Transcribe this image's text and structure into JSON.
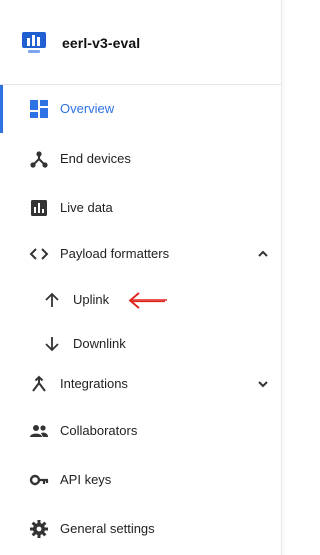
{
  "header": {
    "app_title": "eerl-v3-eval",
    "logo_icon": "monitor-chart-icon"
  },
  "colors": {
    "accent": "#2f72e4",
    "annotation": "#e0201b",
    "icon": "#333333"
  },
  "nav": {
    "items": [
      {
        "label": "Overview",
        "icon": "overview-grid-icon",
        "active": true
      },
      {
        "label": "End devices",
        "icon": "devices-branch-icon"
      },
      {
        "label": "Live data",
        "icon": "bar-chart-icon"
      },
      {
        "label": "Payload formatters",
        "icon": "code-brackets-icon",
        "expanded": true
      },
      {
        "label": "Integrations",
        "icon": "merge-arrow-icon",
        "expanded": false
      },
      {
        "label": "Collaborators",
        "icon": "people-icon"
      },
      {
        "label": "API keys",
        "icon": "key-icon"
      },
      {
        "label": "General settings",
        "icon": "gear-icon"
      }
    ],
    "payload_sub": [
      {
        "label": "Uplink",
        "icon": "arrow-up-icon"
      },
      {
        "label": "Downlink",
        "icon": "arrow-down-icon"
      }
    ]
  },
  "annotation": {
    "icon": "red-hand-drawn-arrow-icon"
  }
}
